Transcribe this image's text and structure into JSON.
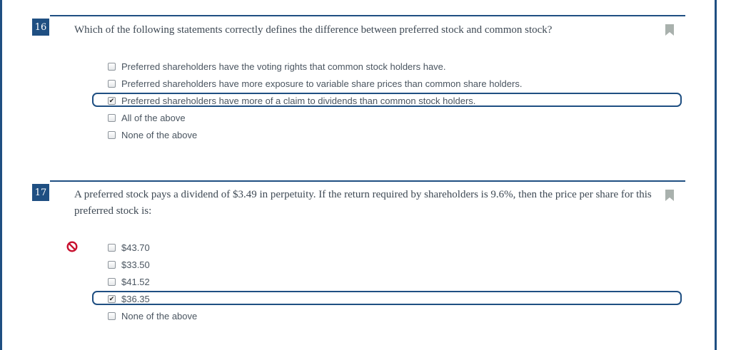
{
  "questions": [
    {
      "number": "16",
      "text": "Which of the following statements correctly defines the difference between preferred stock and common stock?",
      "options": [
        {
          "label": "Preferred shareholders have the voting rights that common stock holders have.",
          "checked": false
        },
        {
          "label": "Preferred shareholders have more exposure to variable share prices than common share holders.",
          "checked": false
        },
        {
          "label": "Preferred shareholders have more of a claim to dividends than common stock holders.",
          "checked": true
        },
        {
          "label": "All of the above",
          "checked": false
        },
        {
          "label": "None of the above",
          "checked": false
        }
      ],
      "result": "none"
    },
    {
      "number": "17",
      "text": "A preferred stock pays a dividend of $3.49 in perpetuity.  If the return required by shareholders is 9.6%, then the price per share for this preferred stock is:",
      "options": [
        {
          "label": "$43.70",
          "checked": false
        },
        {
          "label": "$33.50",
          "checked": false
        },
        {
          "label": "$41.52",
          "checked": false
        },
        {
          "label": "$36.35",
          "checked": true
        },
        {
          "label": "None of the above",
          "checked": false
        }
      ],
      "result": "incorrect"
    }
  ],
  "icons": {
    "bookmark": "bookmark-icon",
    "incorrect": "incorrect-icon"
  },
  "colors": {
    "accent": "#1f4f82",
    "bookmark": "#a9b1ad",
    "incorrect": "#c8102e",
    "text": "#3e4954"
  }
}
